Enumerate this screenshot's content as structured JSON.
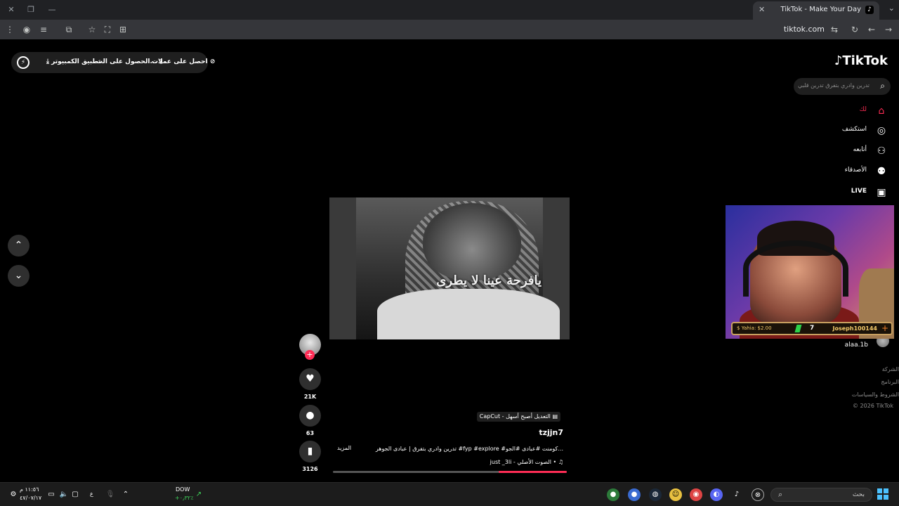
{
  "browser": {
    "tab_title": "TikTok - Make Your Day",
    "url": "tiktok.com"
  },
  "banner": {
    "get_coins": "احصل على عملات",
    "get_app": "الحصول على الت...",
    "desktop_app": "تطبيق الكمبيوتر"
  },
  "sidebar": {
    "logo": "TikTok",
    "search_placeholder": "تدرين وادري بتفرق تدرين قلبي",
    "items": [
      {
        "label": "لك",
        "icon": "home-icon",
        "active": true
      },
      {
        "label": "استكشف",
        "icon": "compass-icon"
      },
      {
        "label": "أتابعه",
        "icon": "following-icon"
      },
      {
        "label": "الأصدقاء",
        "icon": "friends-icon"
      },
      {
        "label": "LIVE",
        "icon": "live-icon"
      }
    ],
    "account": {
      "name": "alaa.1b",
      "handle": "alaa.1b"
    },
    "footer": [
      "الشركة",
      "البرنامج",
      "الشروط والسياسات",
      "© 2026 TikTok"
    ]
  },
  "video": {
    "caption_overlay": "يافرحة عينا لا يطرى",
    "likes": "21K",
    "comments": "63",
    "saves": "3126",
    "capcut_label": "CapCut - التعديل أصبح أسهل",
    "author": "tzjjn7",
    "description": "تدرين وادري بتفرق | عبادى الجوهر #fyp #explore #كومنت #عبادى #الجو...",
    "more": "المزيد",
    "music": "just _3li - الصوت الأصلي •",
    "progress": 0.29,
    "accent": "#fe2c55"
  },
  "webcam": {
    "left_label": "Yahia: $2.00",
    "count": "7",
    "right_label": "Joseph100144"
  },
  "taskbar": {
    "search": "بحث",
    "stock_name": "DOW",
    "stock_change": "+٠٫٣٢٪",
    "time": "١١:٥٦ م",
    "date": "٤٧/٠٧/١٧",
    "lang": "ع"
  }
}
